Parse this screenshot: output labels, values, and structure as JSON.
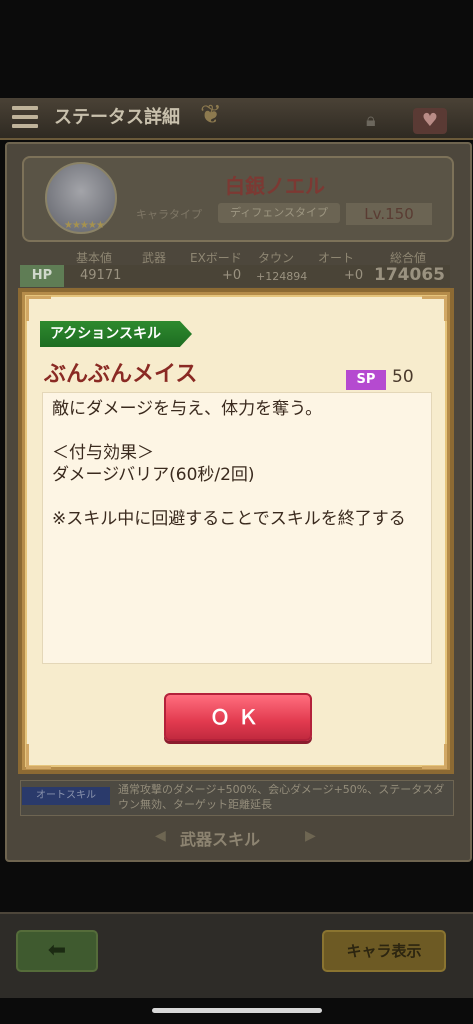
{
  "header": {
    "title": "ステータス詳細"
  },
  "character": {
    "name": "白銀ノエル",
    "type_label": "キャラタイプ",
    "type_value": "ディフェンスタイプ",
    "level": "Lv.150",
    "stars": "★★★★★"
  },
  "stats": {
    "headers": [
      "基本値",
      "武器",
      "EXボード",
      "タウン",
      "オート",
      "総合値"
    ],
    "hp_label": "HP",
    "hp": {
      "base": "49171",
      "weapon": "",
      "exboard": "+0",
      "town": "+124894",
      "auto": "+0",
      "total": "174065"
    }
  },
  "auto_skill": {
    "label": "オートスキル",
    "text": "通常攻撃のダメージ+500%、会心ダメージ+50%、ステータスダウン無効、ターゲット距離延長"
  },
  "weapon_skill_label": "武器スキル",
  "footer": {
    "back_icon": "arrow-left-icon",
    "chara_button": "キャラ表示"
  },
  "dialog": {
    "tag": "アクションスキル",
    "skill_name": "ぶんぶんメイス",
    "sp_label": "SP",
    "sp_value": "50",
    "description": "敵にダメージを与え、体力を奪う。\n\n＜付与効果＞\nダメージバリア(60秒/2回)\n\n※スキル中に回避することでスキルを終了する",
    "ok_label": "ＯＫ"
  },
  "colors": {
    "skill_tag": "#1e6d22",
    "skill_name": "#8a2a24",
    "sp_tag": "#b54ad0",
    "ok_button": "#e23a4f"
  }
}
